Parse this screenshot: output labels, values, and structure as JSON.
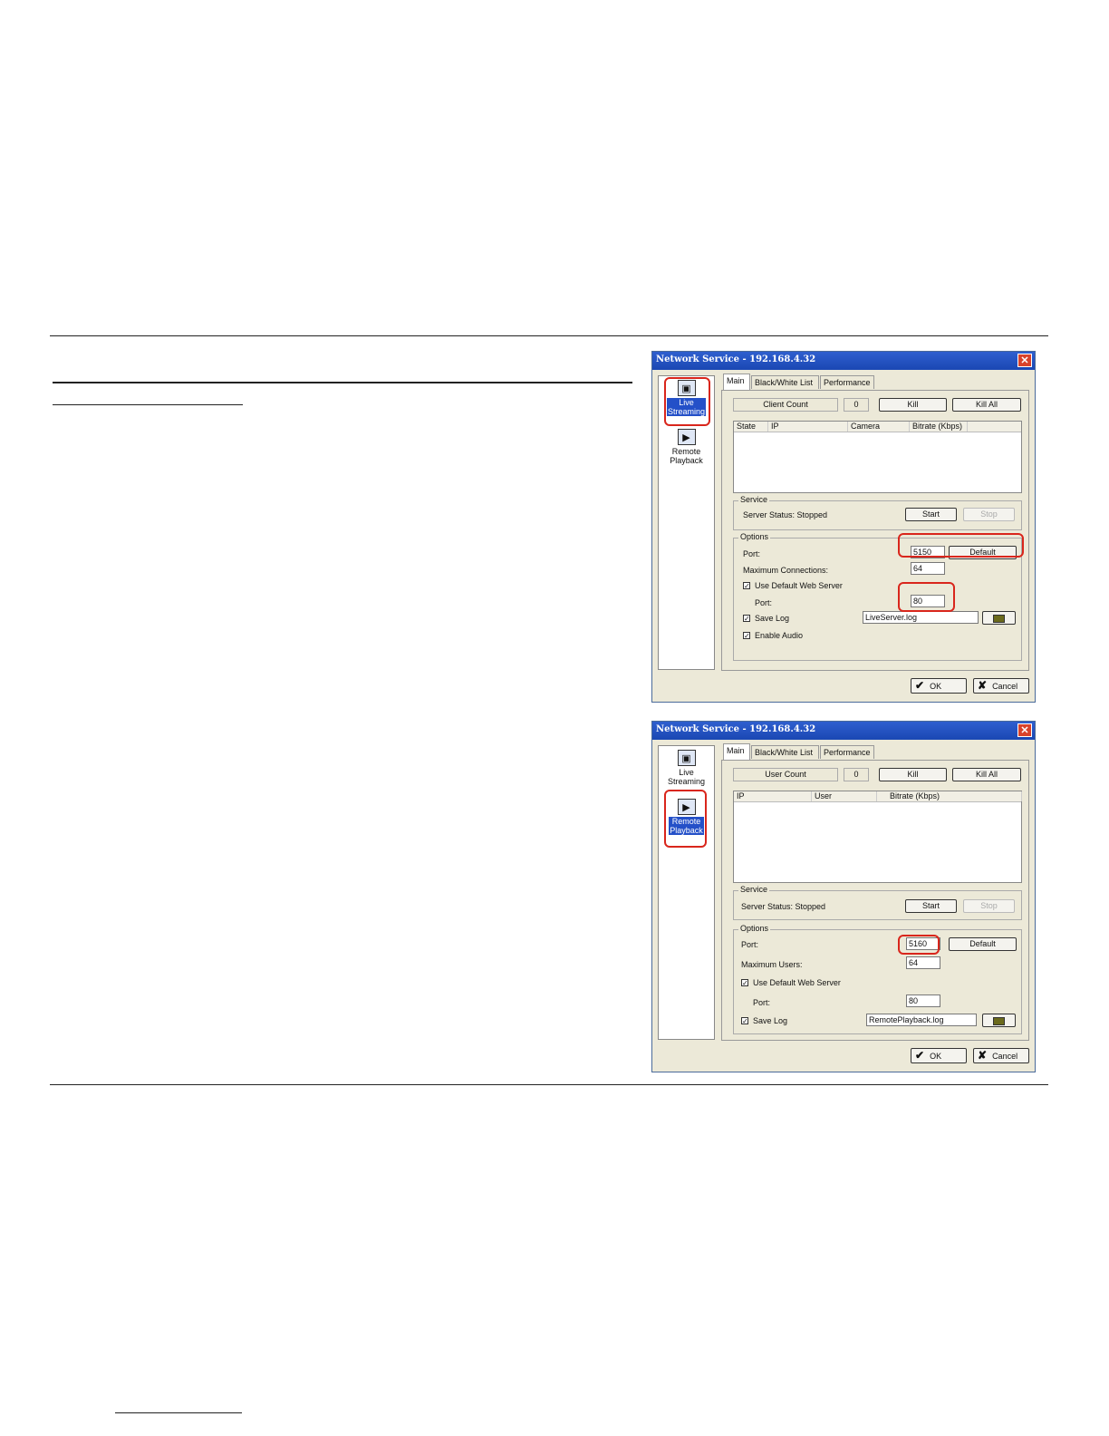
{
  "dialog1": {
    "title": "Network Service - 192.168.4.32",
    "close_label": "✕",
    "nav": [
      {
        "label_line1": "Live",
        "label_line2": "Streaming",
        "icon": "monitor-icon",
        "selected": true
      },
      {
        "label_line1": "Remote",
        "label_line2": "Playback",
        "icon": "play-icon",
        "selected": false
      }
    ],
    "tabs": [
      "Main",
      "Black/White List",
      "Performance"
    ],
    "count_label": "Client Count",
    "count_value": "0",
    "kill_label": "Kill",
    "kill_all_label": "Kill All",
    "columns": [
      "State",
      "IP",
      "Camera",
      "Bitrate (Kbps)"
    ],
    "service_legend": "Service",
    "server_status": "Server Status: Stopped",
    "start_label": "Start",
    "stop_label": "Stop",
    "options_legend": "Options",
    "port_label": "Port:",
    "port_value": "5150",
    "default_label": "Default",
    "max_label": "Maximum Connections:",
    "max_value": "64",
    "web_server_label": "Use Default Web Server",
    "web_port_label": "Port:",
    "web_port_value": "80",
    "save_log_label": "Save Log",
    "log_value": "LiveServer.log",
    "enable_audio_label": "Enable Audio",
    "ok_label": "OK",
    "cancel_label": "Cancel"
  },
  "dialog2": {
    "title": "Network Service - 192.168.4.32",
    "close_label": "✕",
    "nav": [
      {
        "label_line1": "Live",
        "label_line2": "Streaming",
        "icon": "monitor-icon",
        "selected": false
      },
      {
        "label_line1": "Remote",
        "label_line2": "Playback",
        "icon": "play-icon",
        "selected": true
      }
    ],
    "tabs": [
      "Main",
      "Black/White List",
      "Performance"
    ],
    "count_label": "User Count",
    "count_value": "0",
    "kill_label": "Kill",
    "kill_all_label": "Kill All",
    "columns": [
      "IP",
      "User",
      "Bitrate (Kbps)"
    ],
    "service_legend": "Service",
    "server_status": "Server Status: Stopped",
    "start_label": "Start",
    "stop_label": "Stop",
    "options_legend": "Options",
    "port_label": "Port:",
    "port_value": "5160",
    "default_label": "Default",
    "max_label": "Maximum Users:",
    "max_value": "64",
    "web_server_label": "Use Default Web Server",
    "web_port_label": "Port:",
    "web_port_value": "80",
    "save_log_label": "Save Log",
    "log_value": "RemotePlayback.log",
    "ok_label": "OK",
    "cancel_label": "Cancel"
  },
  "glyphs": {
    "check": "✔",
    "cross": "✘",
    "tick": "✓",
    "monitor": "▣",
    "play": "▶"
  },
  "colors": {
    "titlebar": "#1a47b3",
    "highlight": "#d9261c",
    "selection": "#2450c8",
    "dialog_bg": "#ece9d8"
  }
}
